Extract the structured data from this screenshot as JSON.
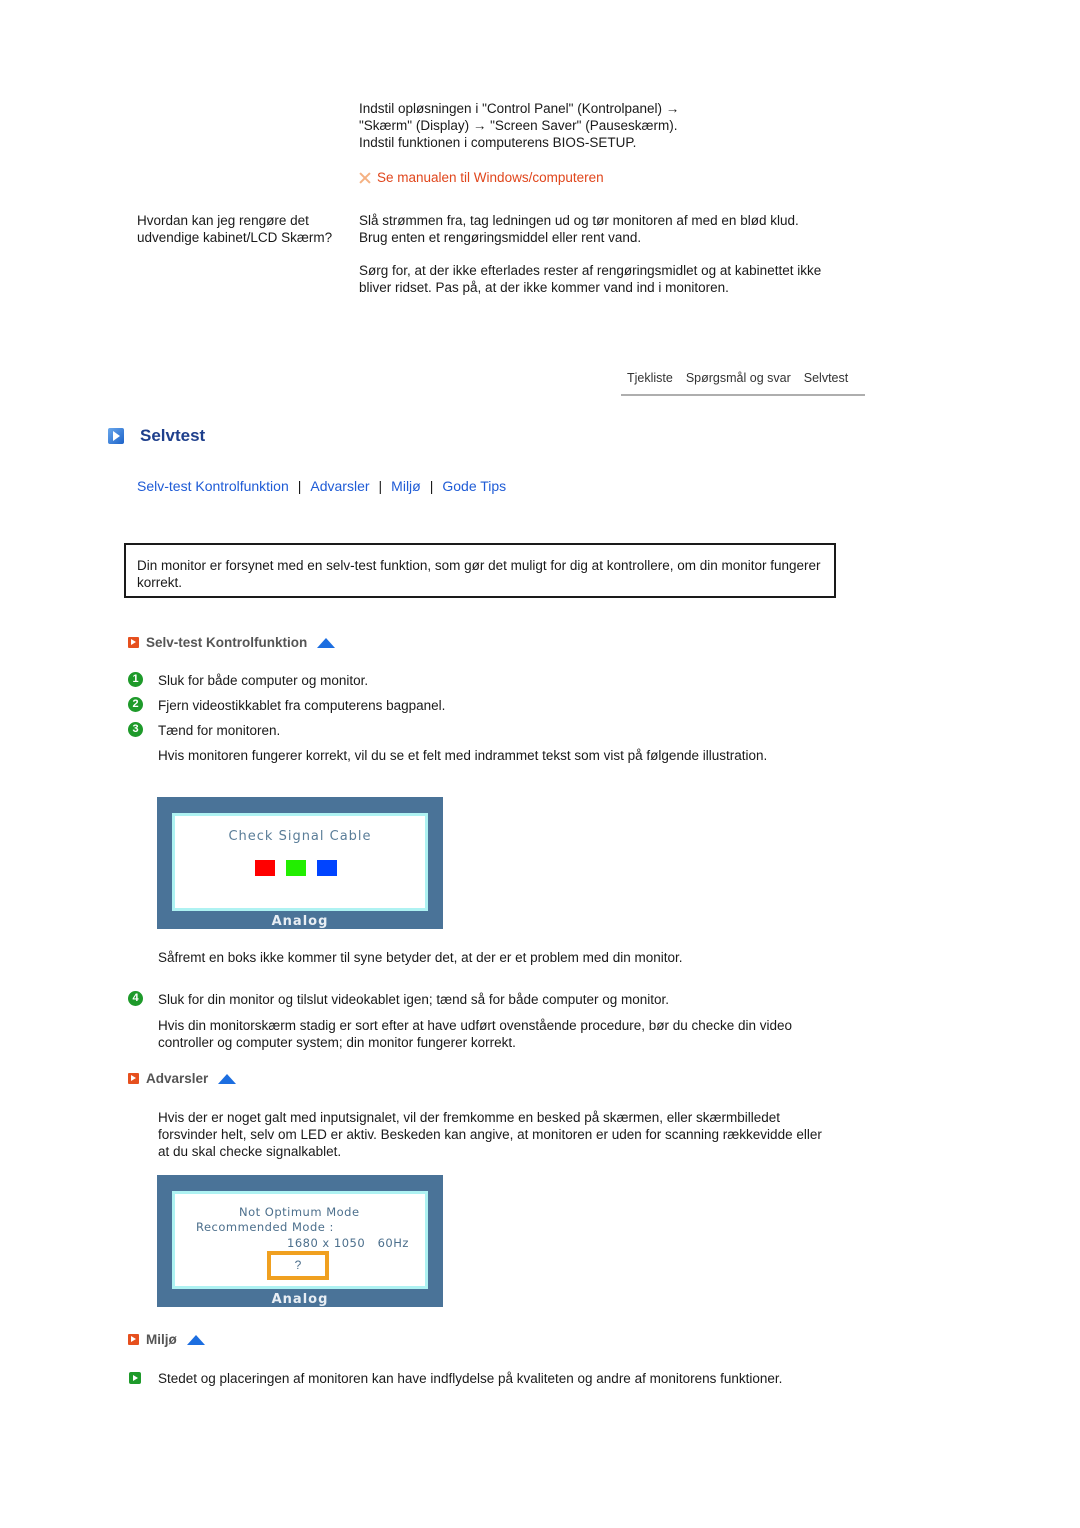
{
  "faq_top": {
    "answer_lines": [
      "Indstil opløsningen i \"Control Panel\" (Kontrolpanel) →",
      "\"Skærm\" (Display) → \"Screen Saver\" (Pauseskærm).",
      "Indstil funktionen i computerens BIOS-SETUP."
    ],
    "note_link": "Se manualen til Windows/computeren"
  },
  "faq": {
    "question": "Hvordan kan jeg rengøre det udvendige kabinet/LCD Skærm?",
    "answer_paragraphs": [
      "Slå strømmen fra, tag ledningen ud og tør monitoren af med en blød klud. Brug enten et rengøringsmiddel eller rent vand.",
      "Sørg for, at der ikke efterlades rester af rengøringsmidlet og at kabinettet ikke bliver ridset. Pas på, at der ikke kommer vand ind i monitoren."
    ]
  },
  "nav_tabs": [
    "Tjekliste",
    "Spørgsmål og svar",
    "Selvtest"
  ],
  "section": {
    "title": "Selvtest",
    "links": [
      "Selv-test Kontrolfunktion",
      "Advarsler",
      "Miljø",
      "Gode Tips"
    ],
    "link_separator": "|",
    "intro": "Din monitor er forsynet med en selv-test funktion, som gør det muligt for dig at kontrollere, om din monitor fungerer korrekt."
  },
  "selftest": {
    "heading": "Selv-test Kontrolfunktion",
    "steps": [
      {
        "num": "1",
        "text": "Sluk for både computer og monitor."
      },
      {
        "num": "2",
        "text": "Fjern videostikkablet fra computerens bagpanel."
      },
      {
        "num": "3",
        "text": "Tænd for monitoren."
      }
    ],
    "step3_note": "Hvis monitoren fungerer korrekt, vil du se et felt med indrammet tekst som vist på følgende illustration.",
    "monitor1": {
      "title": "Check Signal Cable",
      "label": "Analog",
      "squares": [
        "#ff0000",
        "#22ee00",
        "#0044ff"
      ]
    },
    "after_image": "Såfremt en boks ikke kommer til syne betyder det, at der er et problem med din monitor.",
    "step4": {
      "num": "4",
      "text": "Sluk for din monitor og tilslut videokablet igen; tænd så for både computer og monitor."
    },
    "step4_note": "Hvis din monitorskærm stadig er sort efter at have udført ovenstående procedure, bør du checke din video controller og computer system; din monitor fungerer korrekt."
  },
  "warnings": {
    "heading": "Advarsler",
    "text": "Hvis der er noget galt med inputsignalet, vil der fremkomme en besked på skærmen, eller skærmbilledet forsvinder helt, selv om LED er aktiv. Beskeden kan angive, at monitoren er uden for scanning rækkevidde eller at du skal checke signalkablet.",
    "monitor2": {
      "line1": "Not Optimum Mode",
      "line2": "Recommended Mode :",
      "line3": "1680 x 1050   60Hz",
      "qmark": "?",
      "label": "Analog"
    }
  },
  "environment": {
    "heading": "Miljø",
    "text": "Stedet og placeringen af monitoren kan have indflydelse på kvaliteten og andre af monitorens funktioner."
  }
}
